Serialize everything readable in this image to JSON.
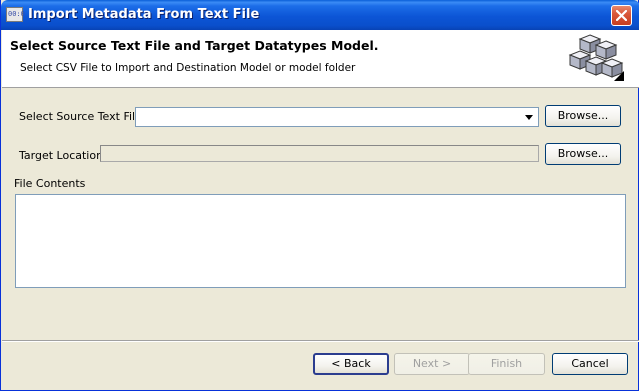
{
  "window": {
    "title": "Import Metadata From Text File",
    "icon": "metadata-import-icon",
    "app_icon_text": "00:0"
  },
  "banner": {
    "title": "Select Source Text File and Target Datatypes Model.",
    "subtitle": "Select CSV File to Import and Destination Model or model folder",
    "icon": "cubes-icon"
  },
  "form": {
    "source_label": "Select Source Text File",
    "source_value": "",
    "browse_label": "Browse...",
    "target_label": "Target Location",
    "target_value": "",
    "contents_label": "File Contents",
    "contents_value": ""
  },
  "footer": {
    "back_label": "< Back",
    "next_label": "Next >",
    "finish_label": "Finish",
    "cancel_label": "Cancel"
  },
  "colors": {
    "titlebar": "#0a55d6",
    "window_bg": "#ece9d8",
    "close_button": "#d9573a",
    "disabled_text": "#a0a0a0"
  }
}
